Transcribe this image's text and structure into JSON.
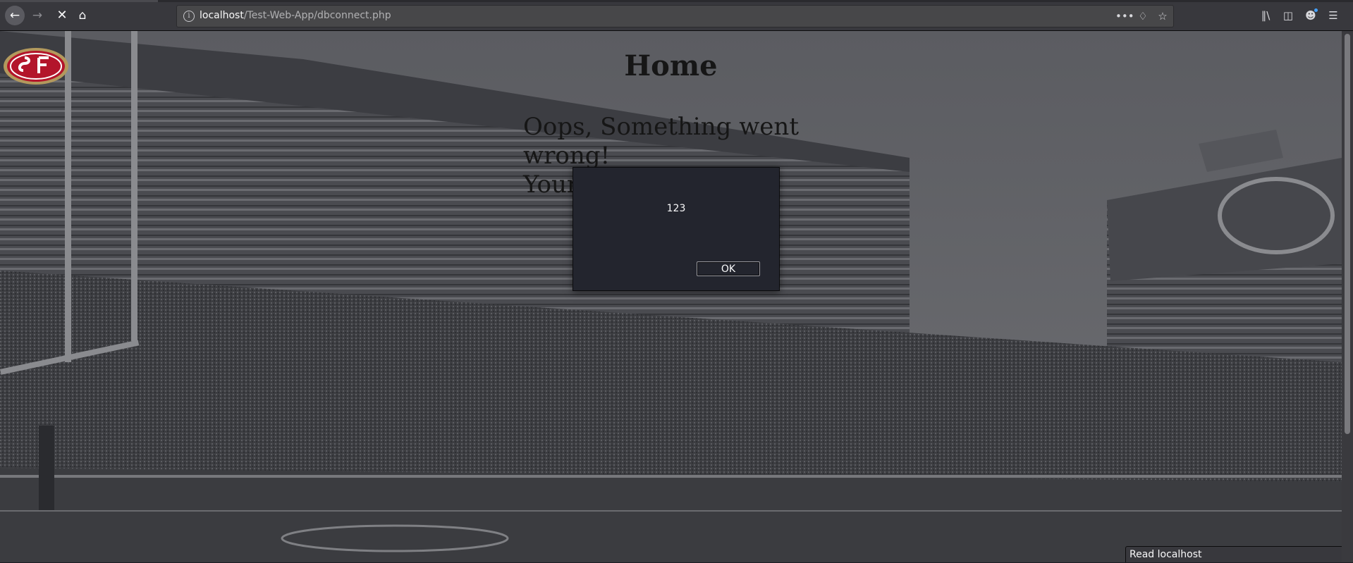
{
  "browser": {
    "url_host": "localhost",
    "url_path": "/Test-Web-App/dbconnect.php",
    "icons": {
      "back": "back-arrow-icon",
      "forward": "forward-arrow-icon",
      "stop": "stop-loading-icon",
      "home": "home-icon",
      "info": "site-info-icon",
      "page_actions": "more-actions-icon",
      "pocket": "pocket-icon",
      "bookmark": "bookmark-star-icon",
      "library": "library-icon",
      "sidebar": "sidebar-icon",
      "account": "account-icon",
      "menu": "hamburger-menu-icon"
    },
    "status_text": "Read localhost"
  },
  "page": {
    "title": "Home",
    "error_line1": "Oops, Something went",
    "error_line2": "wrong!",
    "error_line3": "Your"
  },
  "alert": {
    "message": "123",
    "ok_label": "OK"
  },
  "colors": {
    "chrome_bg": "#38383d",
    "urlbar_bg": "#474749",
    "dialog_bg": "#23252e",
    "logo_red": "#b3152b",
    "logo_gold": "#b3995d"
  }
}
